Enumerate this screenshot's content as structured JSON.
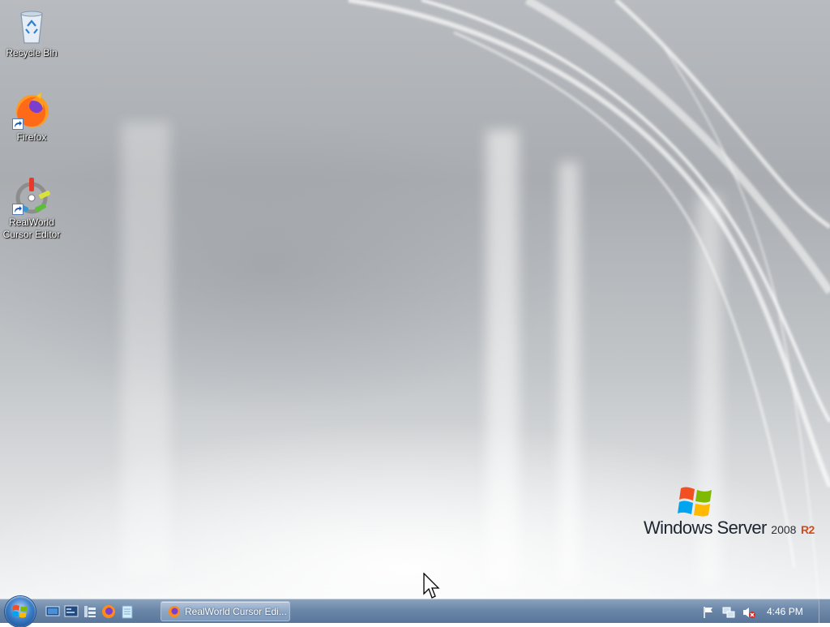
{
  "desktop": {
    "icons": [
      {
        "label": "Recycle Bin",
        "icon": "recycle-bin-icon"
      },
      {
        "label": "Firefox",
        "icon": "firefox-icon"
      },
      {
        "label": "RealWorld Cursor Editor",
        "icon": "realworld-cursor-editor-icon"
      }
    ],
    "branding": {
      "name": "Windows Server",
      "version": "2008",
      "edition": "R2"
    }
  },
  "taskbar": {
    "start_icon": "windows-orb-icon",
    "quick_launch": [
      "show-desktop-icon",
      "server-manager-icon",
      "explorer-icon",
      "firefox-icon",
      "notepad-icon"
    ],
    "tasks": [
      {
        "label": "RealWorld Cursor Edi...",
        "icon": "firefox-icon"
      }
    ],
    "tray": [
      "action-center-flag-icon",
      "network-icon",
      "volume-muted-icon"
    ],
    "clock": "4:46 PM"
  },
  "colors": {
    "taskbar": "#6a86a8",
    "brand_accent": "#d04c1e",
    "desktop": "#b8bbbf"
  }
}
